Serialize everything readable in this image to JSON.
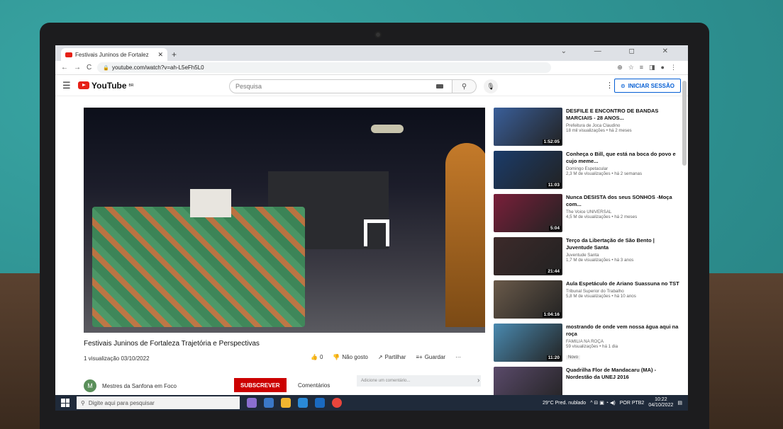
{
  "browser": {
    "tab_title": "Festivais Juninos de Fortalez",
    "tab_close": "✕",
    "new_tab": "+",
    "url": "youtube.com/watch?v=ah-L5eFh5L0",
    "window_controls": "⌄ — ◻ ✕"
  },
  "youtube": {
    "logo_text": "YouTube",
    "logo_country": "BR",
    "search_placeholder": "Pesquisa",
    "signin_label": "INICIAR SESSÃO"
  },
  "video": {
    "title": "Festivais Juninos de Fortaleza Trajetória e Perspectivas",
    "meta": "1 visualização 03/10/2022",
    "likes": "0",
    "dislike_label": "Não gosto",
    "share_label": "Partilhar",
    "save_label": "Guardar",
    "more_label": "···"
  },
  "channel": {
    "avatar_letter": "M",
    "name": "Mestres da Sanfona em Foco",
    "subscribe_label": "SUBSCREVER",
    "comments_label": "Comentários",
    "comment_placeholder": "Adicione um comentário..."
  },
  "recommendations": [
    {
      "title": "DESFILE E ENCONTRO DE BANDAS MARCIAIS - 28 ANOS...",
      "channel": "Prefeitura de Joca Claudino",
      "meta": "18 mil visualizações • há 2 meses",
      "duration": "1:52:05",
      "color": "#3a5f9a"
    },
    {
      "title": "Conheça o Bill, que está na boca do povo e cujo meme...",
      "channel": "Domingo Espetacular",
      "meta": "2,3 M de visualizações • há 2 semanas",
      "duration": "11:03",
      "color": "#1b3c6a"
    },
    {
      "title": "Nunca DESISTA dos seus SONHOS -Moça com...",
      "channel": "The Voice UNIVERSAL",
      "meta": "4,5 M de visualizações • há 2 meses",
      "duration": "5:04",
      "color": "#7a1f3a"
    },
    {
      "title": "Terço da Libertação de São Bento | Juventude Santa",
      "channel": "Juventude Santa",
      "meta": "1,7 M de visualizações • há 3 anos",
      "duration": "21:44",
      "color": "#3d2a2a"
    },
    {
      "title": "Aula Espetáculo de Ariano Suassuna no TST",
      "channel": "Tribunal Superior do Trabalho",
      "meta": "5,8 M de visualizações • há 10 anos",
      "duration": "1:04:16",
      "color": "#6a5a4a"
    },
    {
      "title": "mostrando de onde vem nossa água aqui na roça",
      "channel": "FAMILIA NA ROÇA",
      "meta": "59 visualizações • há 1 dia",
      "duration": "11:20",
      "color": "#4a8ab0",
      "badge": "Novo"
    },
    {
      "title": "Quadrilha Flor de Mandacaru (MA) - Nordestão da UNEJ 2016",
      "channel": "",
      "meta": "",
      "duration": "",
      "color": "#5a4a6a"
    }
  ],
  "taskbar": {
    "search_placeholder": "Digite aqui para pesquisar",
    "weather": "29°C  Pred. nublado",
    "lang": "POR PTB2",
    "time": "10:22",
    "date": "04/10/2022"
  }
}
